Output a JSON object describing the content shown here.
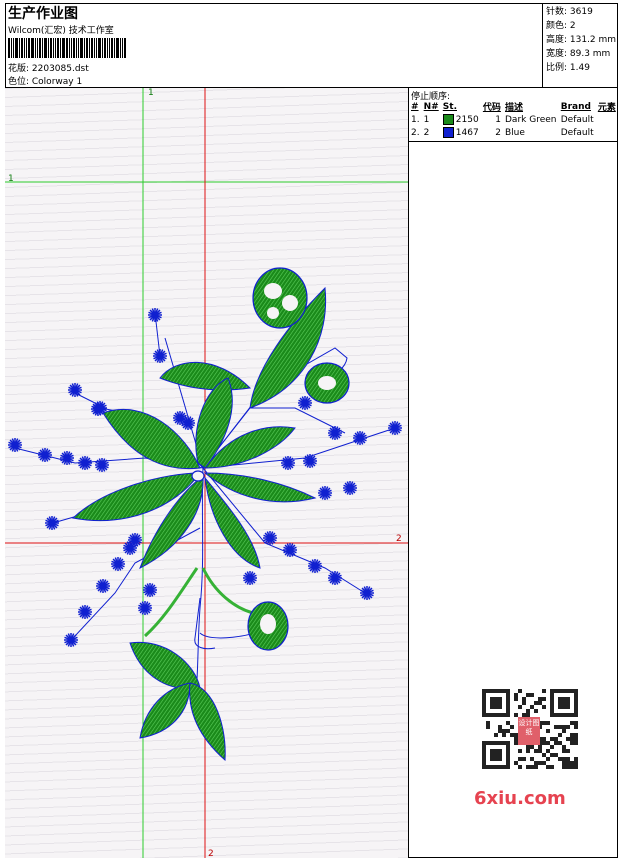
{
  "header": {
    "title": "生产作业图",
    "subtitle": "Wilcom(汇宏) 技术工作室",
    "file_label": "花版: 2203085.dst",
    "colorway_label": "色位: Colorway 1"
  },
  "stats": {
    "stitches": "针数: 3619",
    "colors": "颜色: 2",
    "height": "高度: 131.2 mm",
    "width": "宽度: 89.3 mm",
    "scale": "比例: 1.49"
  },
  "stop_sequence": {
    "heading": "停止顺序:",
    "columns": [
      "#",
      "N#",
      "St.",
      "代码",
      "描述",
      "Brand",
      "元素"
    ],
    "rows": [
      {
        "index": "1.",
        "n": "1",
        "color": "#1a8a1a",
        "stitches": "2150",
        "code": "1",
        "description": "Dark Green",
        "brand": "Default"
      },
      {
        "index": "2.",
        "n": "2",
        "color": "#1020d0",
        "stitches": "1467",
        "code": "2",
        "description": "Blue",
        "brand": "Default"
      }
    ]
  },
  "guides": {
    "green_v_label": "1",
    "green_h_label": "1",
    "red_h_label": "2",
    "red_v_label": "2",
    "green_color": "#2ccc2c",
    "red_color": "#dd1111"
  },
  "design_colors": {
    "green": "#1a8a1a",
    "green_light": "#36b236",
    "blue": "#1020d0"
  },
  "watermark": {
    "text": "6xiu.com",
    "stamp": "设计图纸"
  }
}
